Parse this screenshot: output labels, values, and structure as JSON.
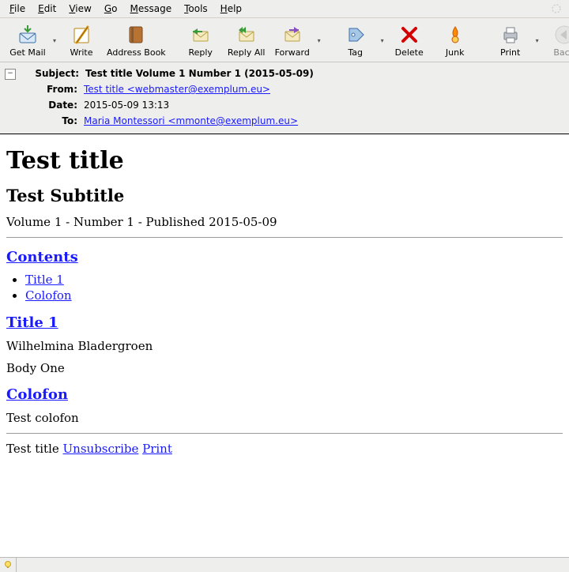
{
  "menubar": {
    "items": [
      {
        "accel": "F",
        "rest": "ile"
      },
      {
        "accel": "E",
        "rest": "dit"
      },
      {
        "accel": "V",
        "rest": "iew"
      },
      {
        "accel": "G",
        "rest": "o"
      },
      {
        "accel": "M",
        "rest": "essage"
      },
      {
        "accel": "T",
        "rest": "ools"
      },
      {
        "accel": "H",
        "rest": "elp"
      }
    ]
  },
  "toolbar": {
    "get_mail": "Get Mail",
    "write": "Write",
    "address_book": "Address Book",
    "reply": "Reply",
    "reply_all": "Reply All",
    "forward": "Forward",
    "tag": "Tag",
    "delete": "Delete",
    "junk": "Junk",
    "print": "Print",
    "back": "Back"
  },
  "headers": {
    "labels": {
      "subject": "Subject:",
      "from": "From:",
      "date": "Date:",
      "to": "To:"
    },
    "subject": "Test title Volume 1 Number 1 (2015-05-09)",
    "from": "Test title <webmaster@exemplum.eu>",
    "date": "2015-05-09 13:13",
    "to": "Maria Montessori <mmonte@exemplum.eu>"
  },
  "body": {
    "title": "Test title",
    "subtitle": "Test Subtitle",
    "publine": "Volume 1 - Number 1 - Published 2015-05-09",
    "contents_heading": "Contents",
    "toc": [
      "Title 1",
      "Colofon"
    ],
    "articles": [
      {
        "heading": "Title 1",
        "author": "Wilhelmina Bladergroen",
        "body": "Body One"
      },
      {
        "heading": "Colofon",
        "body": "Test colofon"
      }
    ],
    "footer": {
      "site": "Test title",
      "unsubscribe": "Unsubscribe",
      "print": "Print"
    }
  }
}
